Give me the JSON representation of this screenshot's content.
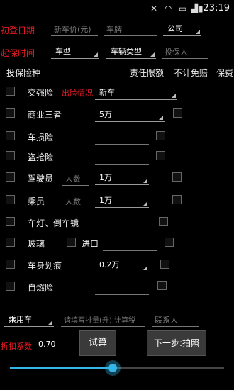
{
  "status": {
    "time": "23:19"
  },
  "top": {
    "first_reg_label": "初登日期",
    "new_price_placeholder": "新车价(元)",
    "plate_placeholder": "车牌",
    "company_value": "公司",
    "start_time_label": "起保时间",
    "car_model_value": "车型",
    "vehicle_type_value": "车辆类型",
    "insured_placeholder": "投保人"
  },
  "columns": {
    "type": "投保险种",
    "limit": "责任限额",
    "no_deductible": "不计免赔",
    "premium": "保费"
  },
  "rows": {
    "jqx": {
      "label": "交强险",
      "extra": "出险情况",
      "value": "新车"
    },
    "szx": {
      "label": "商业三者",
      "value": "5万"
    },
    "csx": {
      "label": "车损险"
    },
    "dqx": {
      "label": "盗抢险"
    },
    "jsy": {
      "label": "驾驶员",
      "count_placeholder": "人数",
      "value": "1万"
    },
    "ck": {
      "label": "乘员",
      "count_placeholder": "人数",
      "value": "1万"
    },
    "cd": {
      "label": "车灯、倒车镜"
    },
    "bl": {
      "label": "玻璃",
      "import_label": "进口"
    },
    "cs": {
      "label": "车身划痕",
      "value": "0.2万"
    },
    "zr": {
      "label": "自燃险"
    }
  },
  "bottom": {
    "car_type_value": "乘用车",
    "displacement_placeholder": "请填写排量(升),计算税",
    "contact_placeholder": "联系人",
    "discount_label": "折扣系数",
    "discount_value": "0.70",
    "calc_button": "试算",
    "next_button": "下一步:拍照"
  },
  "slider": {
    "value": 0.48
  },
  "colors": {
    "accent": "#33b5e5",
    "red": "#e51c23"
  }
}
